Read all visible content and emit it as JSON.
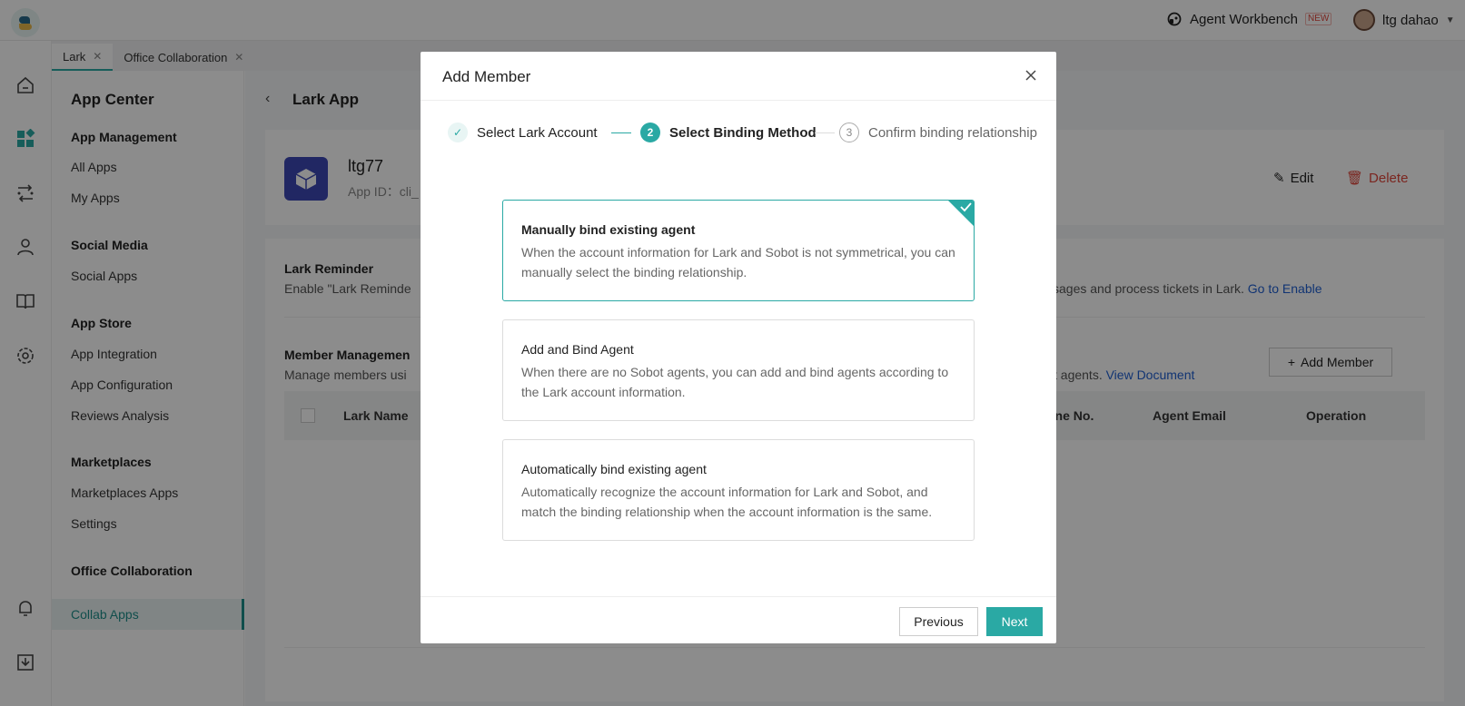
{
  "topbar": {
    "workbench_label": "Agent Workbench",
    "new_badge": "NEW",
    "user_name": "ltg dahao"
  },
  "tabs": [
    {
      "label": "Lark",
      "active": true
    },
    {
      "label": "Office Collaboration",
      "active": false
    }
  ],
  "subnav": {
    "title": "App Center",
    "sections": {
      "app_management": "App Management",
      "social_media": "Social Media",
      "app_store": "App Store",
      "marketplaces": "Marketplaces",
      "office_collaboration": "Office Collaboration"
    },
    "items": {
      "all_apps": "All Apps",
      "my_apps": "My Apps",
      "social_apps": "Social Apps",
      "app_integration": "App Integration",
      "app_configuration": "App Configuration",
      "reviews_analysis": "Reviews Analysis",
      "marketplaces_apps": "Marketplaces Apps",
      "settings": "Settings",
      "collab_apps": "Collab Apps"
    }
  },
  "main": {
    "title": "Lark App",
    "app_name": "ltg77",
    "app_id_label": "App ID：cli_",
    "edit_label": "Edit",
    "delete_label": "Delete",
    "reminder_title": "Lark Reminder",
    "reminder_desc_left": "Enable \"Lark Reminde",
    "reminder_desc_right": "ssages and process tickets in Lark.",
    "go_to_enable": "Go to Enable",
    "member_title": "Member Managemen",
    "member_desc_left": "Manage members usi",
    "member_desc_right": "t agents.",
    "view_document": "View Document",
    "add_member_button": "Add Member",
    "table_headers": {
      "lark_name": "Lark Name",
      "phone": "one No.",
      "agent_email": "Agent Email",
      "operation": "Operation"
    }
  },
  "modal": {
    "title": "Add Member",
    "steps": [
      {
        "number": "✓",
        "label": "Select Lark Account",
        "state": "done"
      },
      {
        "number": "2",
        "label": "Select Binding Method",
        "state": "current"
      },
      {
        "number": "3",
        "label": "Confirm binding relationship",
        "state": "todo"
      }
    ],
    "options": [
      {
        "title": "Manually bind existing agent",
        "desc": "When the account information for Lark and Sobot is not symmetrical, you can manually select the binding relationship.",
        "selected": true
      },
      {
        "title": "Add and Bind Agent",
        "desc": "When there are no Sobot agents, you can add and bind agents according to the Lark account information.",
        "selected": false
      },
      {
        "title": "Automatically bind existing agent",
        "desc": "Automatically recognize the account information for Lark and Sobot, and match the binding relationship when the account information is the same.",
        "selected": false
      }
    ],
    "previous_label": "Previous",
    "next_label": "Next"
  },
  "colors": {
    "accent": "#2aa9a4",
    "danger": "#e0463b",
    "link": "#1f5fd1"
  }
}
